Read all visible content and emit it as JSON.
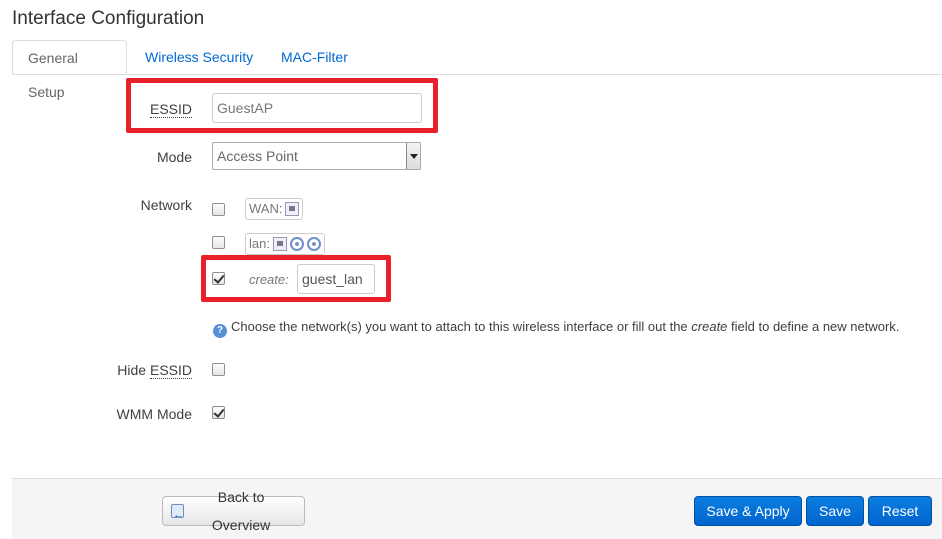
{
  "page": {
    "title": "Interface Configuration"
  },
  "tabs": [
    {
      "label": "General Setup",
      "active": true
    },
    {
      "label": "Wireless Security",
      "active": false
    },
    {
      "label": "MAC-Filter",
      "active": false
    }
  ],
  "form": {
    "essid": {
      "label": "ESSID",
      "value": "GuestAP"
    },
    "mode": {
      "label": "Mode",
      "selected": "Access Point"
    },
    "network": {
      "label": "Network",
      "options": [
        {
          "label": "WAN:",
          "checked": false,
          "icons": [
            "ethernet-port-icon"
          ]
        },
        {
          "label": "lan:",
          "checked": false,
          "icons": [
            "ethernet-port-icon",
            "wifi-icon",
            "wifi-icon"
          ]
        }
      ],
      "create": {
        "label": "create:",
        "checked": true,
        "value": "guest_lan"
      },
      "help": {
        "prefix": "Choose the network(s) you want to attach to this wireless interface or fill out the ",
        "emphasis": "create",
        "suffix": " field to define a new network."
      }
    },
    "hide_essid": {
      "label_prefix": "Hide ",
      "label_abbr": "ESSID",
      "checked": false
    },
    "wmm_mode": {
      "label": "WMM Mode",
      "checked": true
    }
  },
  "footer": {
    "back_label": "Back to Overview",
    "save_apply_label": "Save & Apply",
    "save_label": "Save",
    "reset_label": "Reset"
  },
  "colors": {
    "highlight_red": "#e8202a",
    "primary_blue": "#0064cd",
    "link_blue": "#0069d6"
  }
}
